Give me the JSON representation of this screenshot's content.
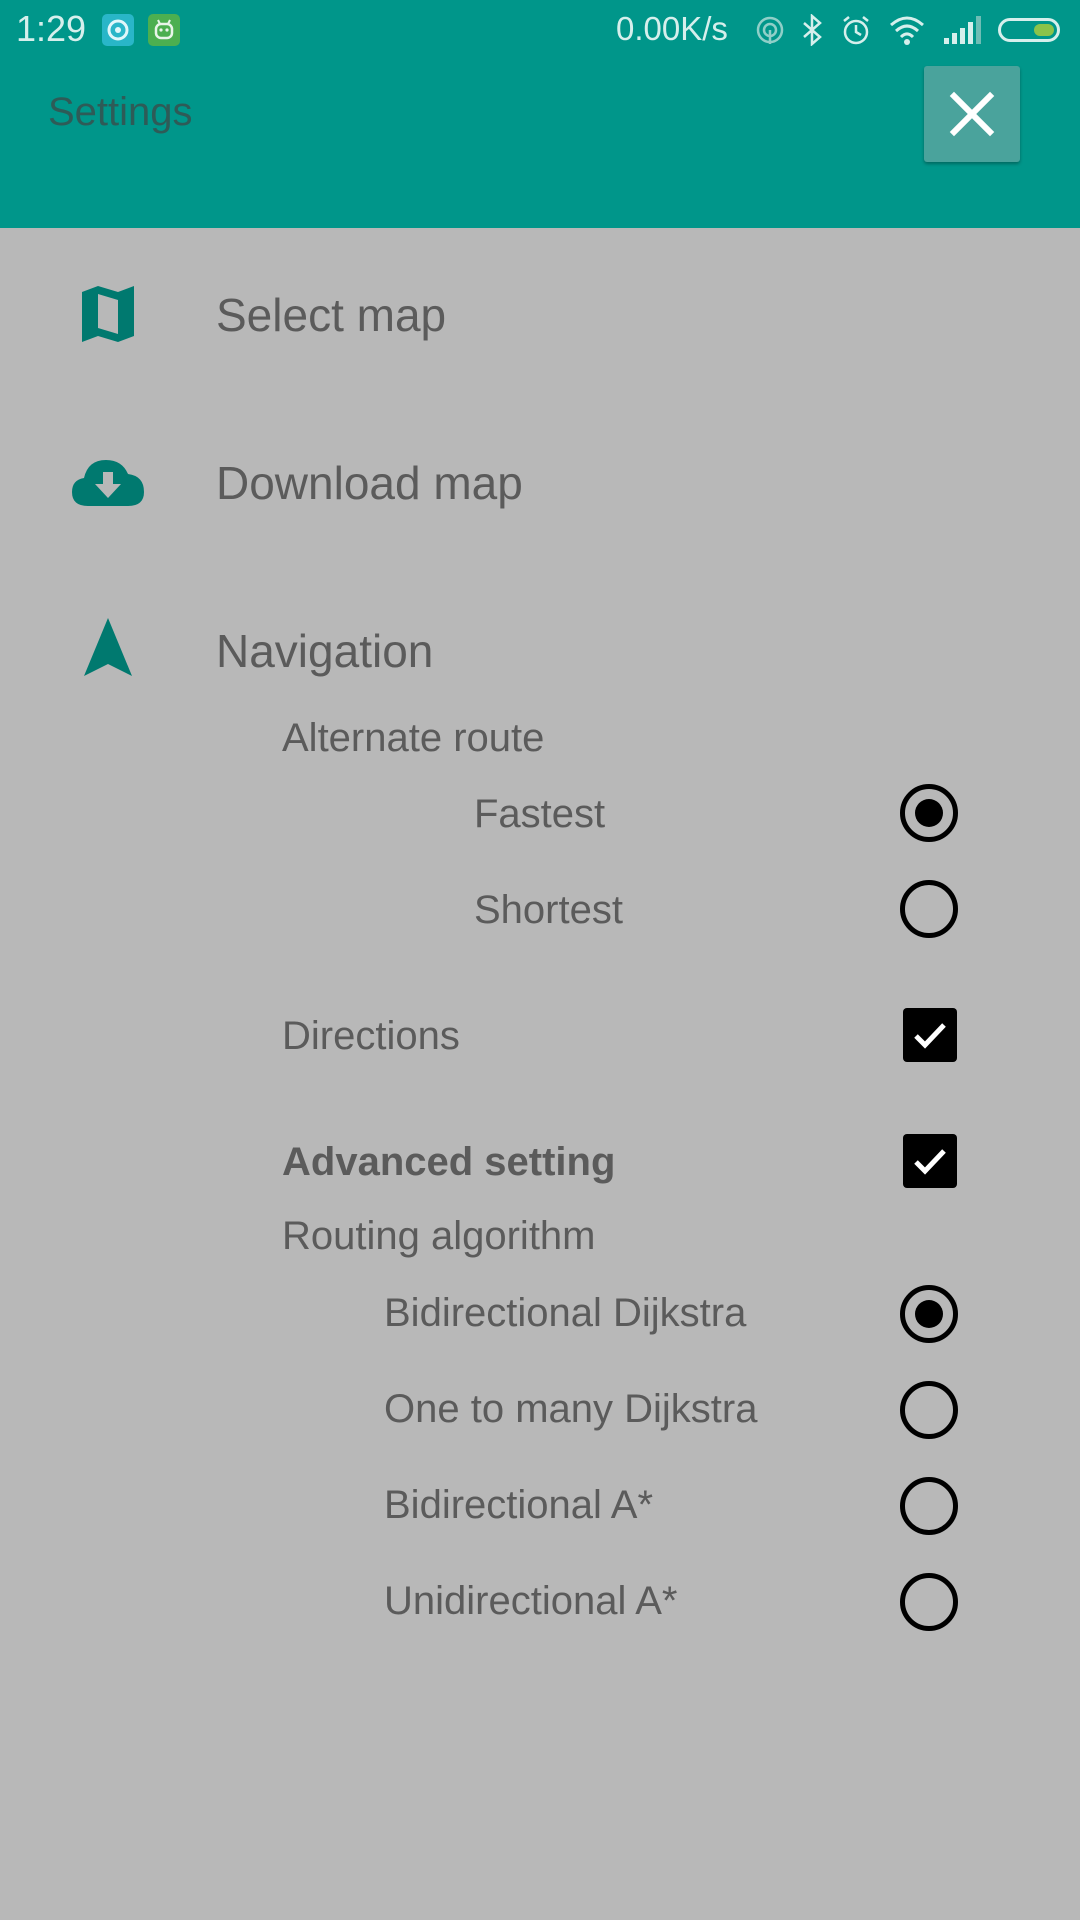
{
  "status_bar": {
    "time": "1:29",
    "net_speed": "0.00K/s",
    "icons": [
      "notification-app-icon",
      "android-app-icon",
      "hotspot-icon",
      "bluetooth-icon",
      "alarm-icon",
      "wifi-icon",
      "signal-icon",
      "battery-icon"
    ]
  },
  "app_bar": {
    "title": "Settings",
    "close_icon": "close-icon"
  },
  "menu": {
    "select_map": {
      "label": "Select map",
      "icon": "map-icon"
    },
    "download_map": {
      "label": "Download map",
      "icon": "cloud-download-icon"
    },
    "navigation": {
      "label": "Navigation",
      "icon": "navigation-arrow-icon"
    }
  },
  "navigation": {
    "alternate_route": {
      "label": "Alternate route",
      "options": [
        {
          "label": "Fastest",
          "selected": true
        },
        {
          "label": "Shortest",
          "selected": false
        }
      ]
    },
    "directions": {
      "label": "Directions",
      "checked": true
    },
    "advanced_setting": {
      "label": "Advanced setting",
      "checked": true
    },
    "routing_algorithm": {
      "label": "Routing algorithm",
      "options": [
        {
          "label": "Bidirectional Dijkstra",
          "selected": true
        },
        {
          "label": "One to many Dijkstra",
          "selected": false
        },
        {
          "label": "Bidirectional A*",
          "selected": false
        },
        {
          "label": "Unidirectional A*",
          "selected": false
        }
      ]
    }
  },
  "colors": {
    "primary": "#00968a",
    "background": "#b8b8b8",
    "icon_tint": "#00796f",
    "text": "#5b5b5b"
  }
}
